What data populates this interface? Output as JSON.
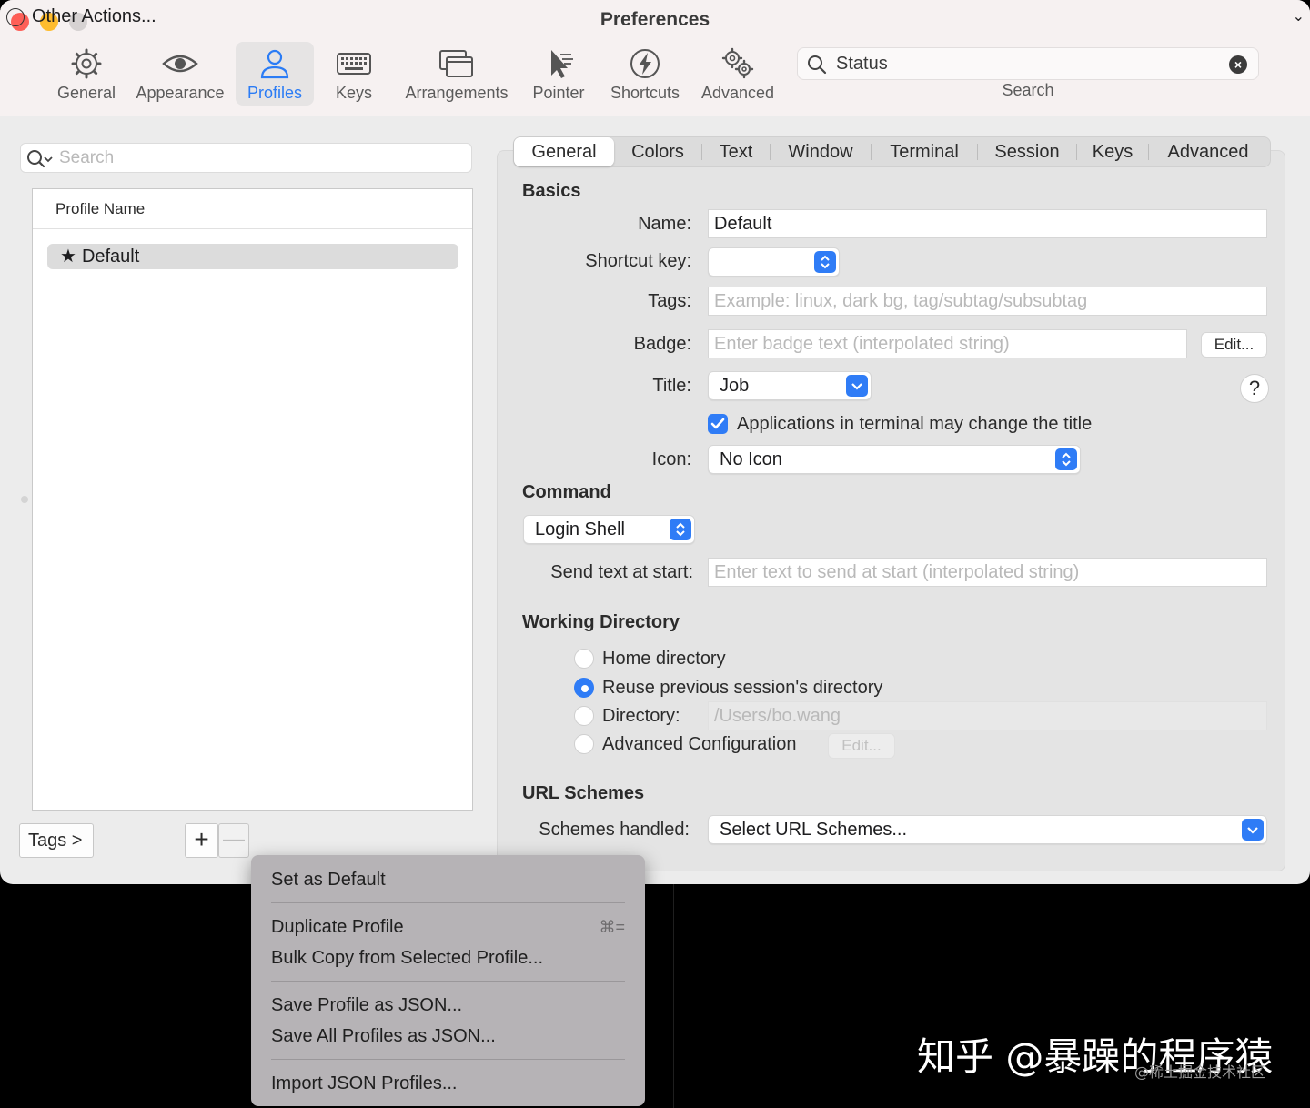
{
  "window": {
    "title": "Preferences"
  },
  "toolbar": {
    "items": [
      {
        "label": "General",
        "icon": "gear-icon"
      },
      {
        "label": "Appearance",
        "icon": "eye-icon"
      },
      {
        "label": "Profiles",
        "icon": "person-icon"
      },
      {
        "label": "Keys",
        "icon": "keyboard-icon"
      },
      {
        "label": "Arrangements",
        "icon": "windows-icon"
      },
      {
        "label": "Pointer",
        "icon": "pointer-icon"
      },
      {
        "label": "Shortcuts",
        "icon": "bolt-icon"
      },
      {
        "label": "Advanced",
        "icon": "gears-icon"
      }
    ],
    "search": {
      "value": "Status",
      "label": "Search"
    }
  },
  "profiles": {
    "search_placeholder": "Search",
    "header": "Profile Name",
    "rows": [
      "Default"
    ],
    "tags_label": "Tags >",
    "add_label": "+",
    "remove_label": "—",
    "other_actions_label": "Other Actions..."
  },
  "tabs": [
    "General",
    "Colors",
    "Text",
    "Window",
    "Terminal",
    "Session",
    "Keys",
    "Advanced"
  ],
  "basics": {
    "heading": "Basics",
    "name_label": "Name:",
    "name_value": "Default",
    "shortcut_label": "Shortcut key:",
    "tags_label": "Tags:",
    "tags_placeholder": "Example: linux, dark bg, tag/subtag/subsubtag",
    "badge_label": "Badge:",
    "badge_placeholder": "Enter badge text (interpolated string)",
    "badge_edit": "Edit...",
    "title_label": "Title:",
    "title_value": "Job",
    "help": "?",
    "apps_change_title": "Applications in terminal may change the title",
    "icon_label": "Icon:",
    "icon_value": "No Icon"
  },
  "command": {
    "heading": "Command",
    "shell_value": "Login Shell",
    "send_text_label": "Send text at start:",
    "send_text_placeholder": "Enter text to send at start (interpolated string)"
  },
  "working_directory": {
    "heading": "Working Directory",
    "options": [
      "Home directory",
      "Reuse previous session's directory",
      "Directory:",
      "Advanced Configuration"
    ],
    "selected": "Reuse previous session's directory",
    "directory_value": "/Users/bo.wang",
    "edit_label": "Edit..."
  },
  "url_schemes": {
    "heading": "URL Schemes",
    "label": "Schemes handled:",
    "value": "Select URL Schemes..."
  },
  "menu": {
    "items": [
      {
        "label": "Set as Default",
        "shortcut": ""
      },
      {
        "label": "Duplicate Profile",
        "shortcut": "⌘="
      },
      {
        "label": "Bulk Copy from Selected Profile...",
        "shortcut": ""
      },
      {
        "label": "Save Profile as JSON...",
        "shortcut": ""
      },
      {
        "label": "Save All Profiles as JSON...",
        "shortcut": ""
      },
      {
        "label": "Import JSON Profiles...",
        "shortcut": ""
      }
    ]
  },
  "watermark": {
    "main": "知乎 @暴躁的程序猿",
    "sub": "@稀土掘金技术社区"
  },
  "colors": {
    "accent": "#2f7cf6",
    "close": "#fe5f57",
    "minimize": "#febc2e"
  }
}
